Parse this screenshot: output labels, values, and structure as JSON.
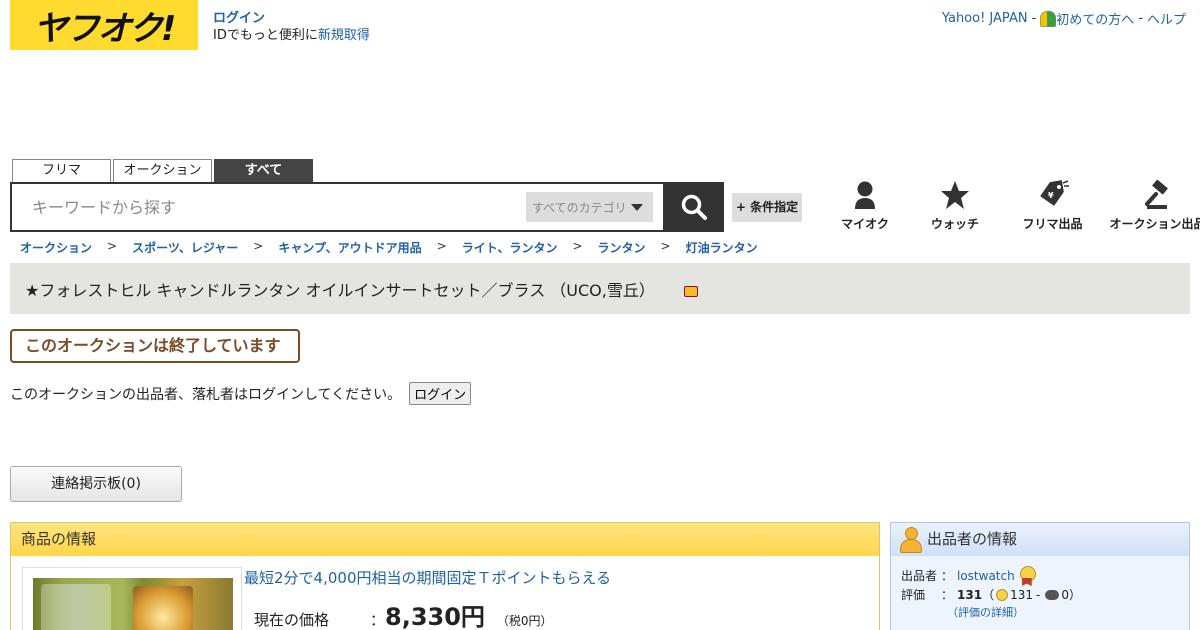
{
  "header": {
    "logo_text": "ヤフオク!",
    "login_label": "ログイン",
    "login_sub": "IDでもっと便利に",
    "signup_label": "新規取得",
    "top_links": {
      "yahoo": "Yahoo! JAPAN",
      "sep1": "-",
      "beginner": "初めての方へ",
      "sep2": "-",
      "help": "ヘルプ"
    }
  },
  "tabs": [
    {
      "label": "フリマ",
      "active": false
    },
    {
      "label": "オークション",
      "active": false
    },
    {
      "label": "すべて",
      "active": true
    }
  ],
  "search": {
    "placeholder": "キーワードから探す",
    "value": "",
    "category": "すべてのカテゴリ",
    "condition_label": "+ 条件指定"
  },
  "nav": [
    {
      "label": "マイオク",
      "icon": "person-icon"
    },
    {
      "label": "ウォッチ",
      "icon": "star-icon"
    },
    {
      "label": "フリマ出品",
      "icon": "tag-icon"
    },
    {
      "label": "オークション出品",
      "icon": "gavel-icon"
    }
  ],
  "breadcrumb": [
    "オークション",
    "スポーツ、レジャー",
    "キャンプ、アウトドア用品",
    "ライト、ランタン",
    "ランタン",
    "灯油ランタン"
  ],
  "breadcrumb_sep": ">",
  "item": {
    "title": "★フォレストヒル キャンドルランタン オイルインサートセット／ブラス （UCO,雪丘）",
    "ended_label": "このオークションは終了しています",
    "login_notice": "このオークションの出品者、落札者はログインしてください。",
    "login_button": "ログイン",
    "board_button": "連絡掲示板(0)"
  },
  "item_panel": {
    "heading": "商品の情報",
    "promo": "最短2分で4,000円相当の期間固定Ｔポイントもらえる",
    "price_label": "現在の価格",
    "colon": "：",
    "price": "8,330円",
    "tax": "（税0円）"
  },
  "seller": {
    "heading": "出品者の情報",
    "seller_label": "出品者",
    "seller_name": "lostwatch",
    "rating_label": "評価",
    "colon": "：",
    "rating_total": "131",
    "paren_open": "（",
    "good_count": "131",
    "dash": "-",
    "bad_count": "0",
    "paren_close": "）",
    "detail_link": "（評価の詳細）"
  }
}
